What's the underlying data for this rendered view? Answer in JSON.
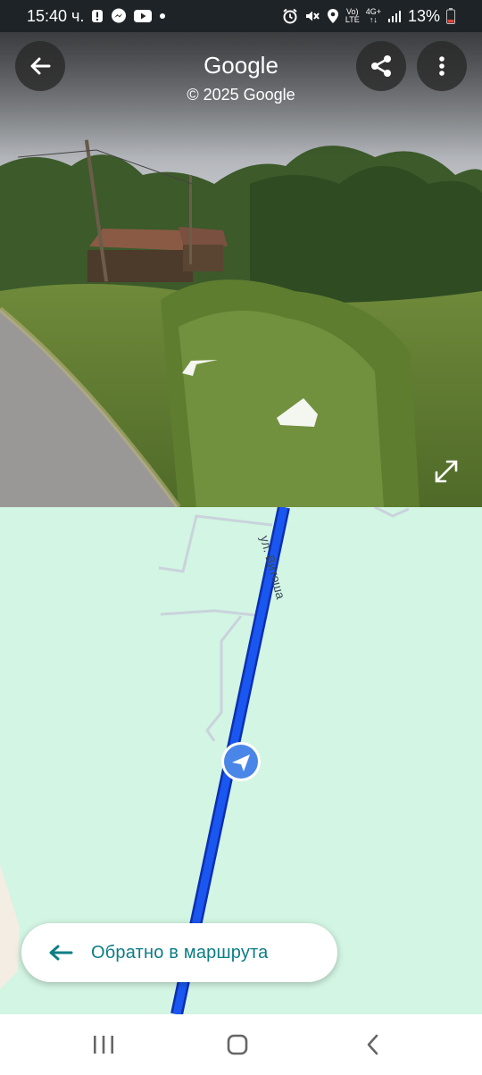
{
  "status_bar": {
    "time": "15:40 ч.",
    "battery": "13%",
    "network_top": "Vo)",
    "network_bottom": "LTE",
    "signal_gen": "4G+",
    "left_icons": [
      "alert-icon",
      "messenger-icon",
      "youtube-icon",
      "dot-icon"
    ],
    "right_icons": [
      "alarm-icon",
      "mute-icon",
      "location-icon",
      "signal-icon",
      "battery-icon"
    ]
  },
  "street_view": {
    "title": "Google",
    "copyright": "© 2025 Google",
    "buttons": [
      "back-button",
      "share-button",
      "more-options-button",
      "expand-button"
    ]
  },
  "map": {
    "street_label": "ул. Витоша",
    "route_color": "#1a4fe0",
    "background_color": "#d3f5e3",
    "back_to_route_label": "Обратно в маршрута",
    "accent_color": "#0b7d85"
  },
  "nav_bar": {
    "buttons": [
      "recent-apps-button",
      "home-button",
      "back-nav-button"
    ]
  }
}
